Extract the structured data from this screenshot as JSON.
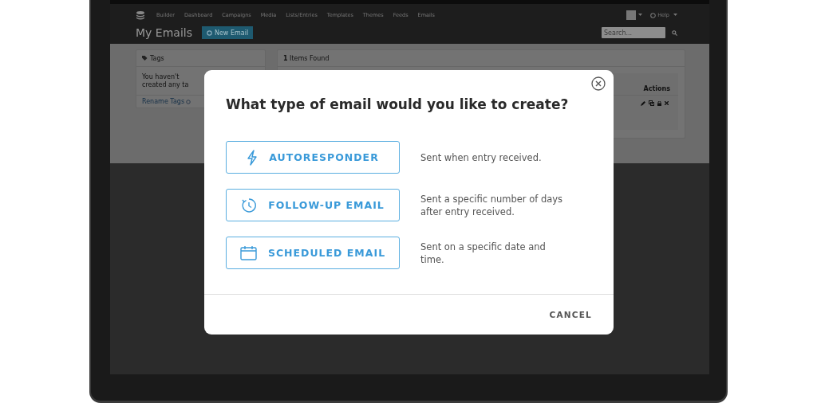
{
  "nav": {
    "items": [
      "Builder",
      "Dashboard",
      "Campaigns",
      "Media",
      "Lists/Entries",
      "Templates",
      "Themes",
      "Feeds",
      "Emails"
    ],
    "help": "Help"
  },
  "page": {
    "title": "My Emails",
    "new_button": "New Email",
    "search": {
      "placeholder": "Search..."
    }
  },
  "tags_panel": {
    "title": "Tags",
    "message": "You haven't created any ta",
    "link": "Rename Tags"
  },
  "results_panel": {
    "count": "**1** Items Found",
    "actions_header": "Actions"
  },
  "modal": {
    "title": "What type of email would you like to create?",
    "options": [
      {
        "kind": "autoresponder",
        "label": "AUTORESPONDER",
        "description": "Sent when entry received."
      },
      {
        "kind": "follow_up",
        "label": "FOLLOW-UP EMAIL",
        "description": "Sent a specific number of days after entry received."
      },
      {
        "kind": "scheduled",
        "label": "SCHEDULED EMAIL",
        "description": "Sent on a specific date and time."
      }
    ],
    "cancel": "CANCEL"
  }
}
